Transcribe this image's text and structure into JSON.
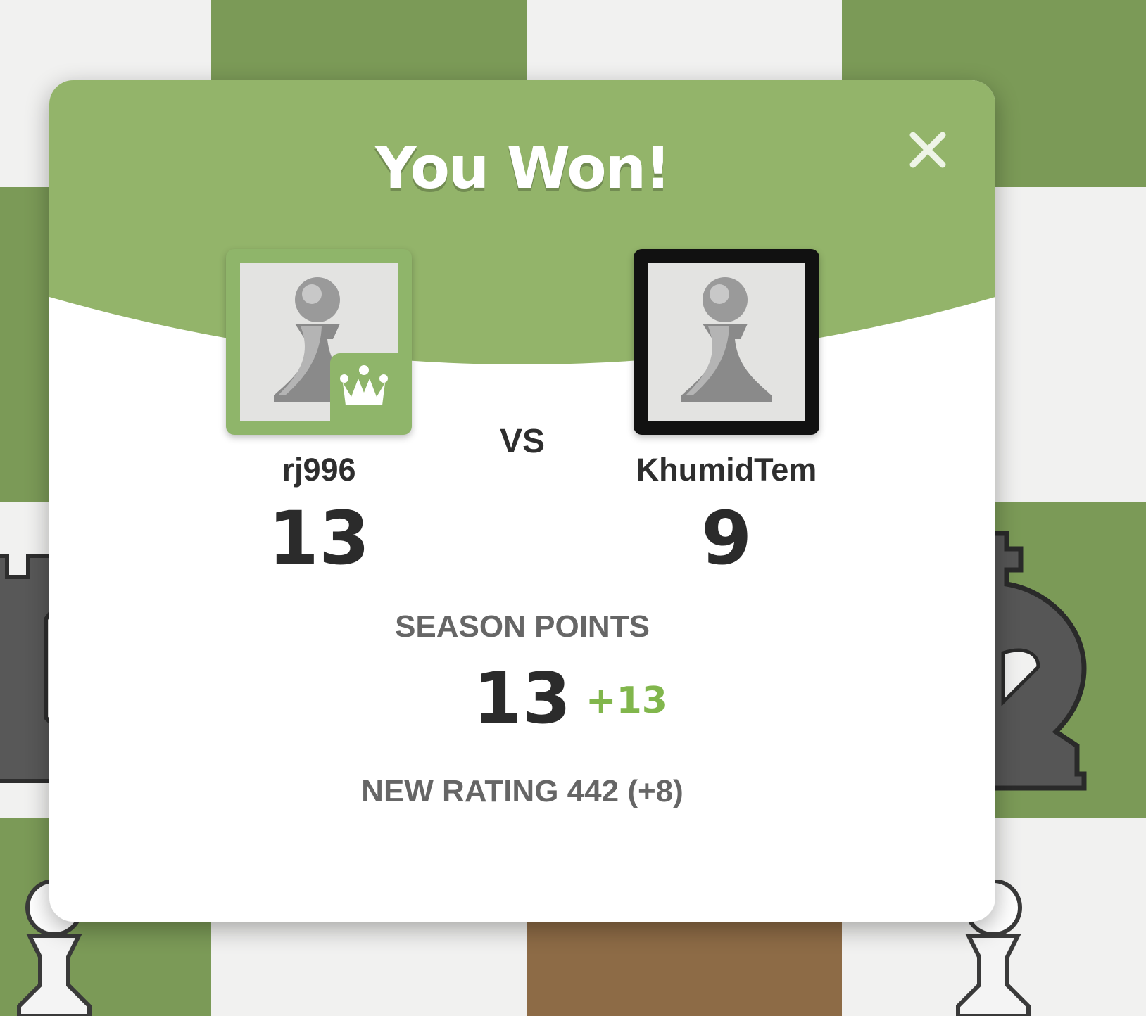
{
  "modal": {
    "title": "You Won!",
    "close_icon": "close-icon",
    "header_color": "#93b46a",
    "vs_label": "VS"
  },
  "players": {
    "left": {
      "name": "rj996",
      "score": "13",
      "avatar_icon": "pawn-icon",
      "badge_icon": "crown-icon"
    },
    "right": {
      "name": "KhumidTem",
      "score": "9",
      "avatar_icon": "pawn-icon"
    }
  },
  "season": {
    "label": "SEASON POINTS",
    "points": "13",
    "delta": "+13"
  },
  "rating": {
    "label": "NEW RATING",
    "value": "442",
    "change": "(+8)"
  },
  "colors": {
    "board_light": "#f1f1f0",
    "board_dark": "#7b9a57",
    "accent_green": "#81b64c"
  }
}
